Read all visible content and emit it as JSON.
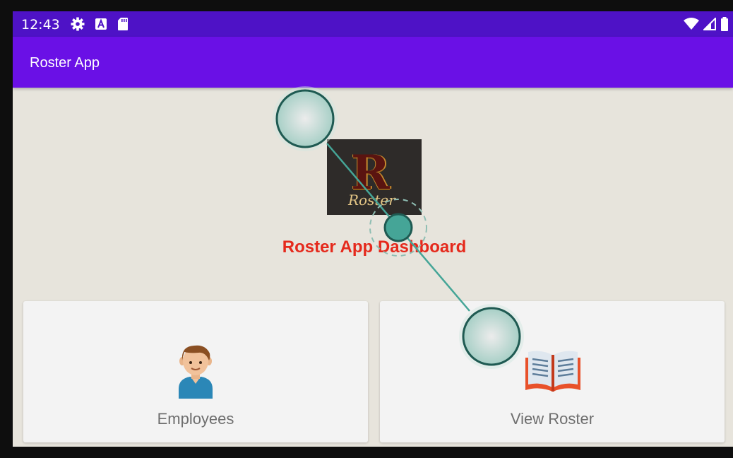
{
  "status_bar": {
    "time": "12:43",
    "icons_left": [
      "gear-icon",
      "a-square-icon",
      "sd-card-icon"
    ],
    "icons_right": [
      "wifi-icon",
      "signal-icon",
      "battery-icon"
    ]
  },
  "app_bar": {
    "title": "Roster App"
  },
  "logo": {
    "letter": "R",
    "word": "Roster"
  },
  "dashboard": {
    "title": "Roster App Dashboard",
    "title_color": "#e5291c"
  },
  "cards": [
    {
      "label": "Employees",
      "icon": "employee-icon"
    },
    {
      "label": "View Roster",
      "icon": "open-book-icon"
    }
  ],
  "colors": {
    "status_bar": "#4e12c6",
    "app_bar": "#6a10e6",
    "background": "#e7e4dc",
    "card": "#f3f3f3",
    "gesture_accent": "#45a597"
  },
  "gesture_overlay": {
    "type": "drag",
    "icons": [
      "touch-point-icon",
      "touch-point-icon",
      "center-handle-icon"
    ]
  }
}
